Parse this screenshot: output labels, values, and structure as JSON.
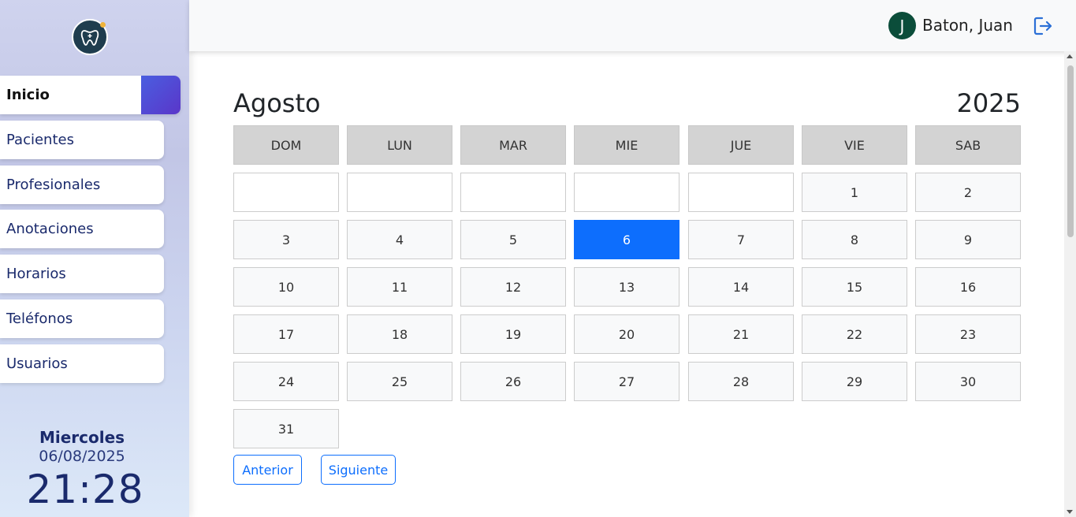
{
  "sidebar": {
    "items": [
      {
        "label": "Inicio",
        "active": true
      },
      {
        "label": "Pacientes"
      },
      {
        "label": "Profesionales"
      },
      {
        "label": "Anotaciones"
      },
      {
        "label": "Horarios"
      },
      {
        "label": "Teléfonos"
      },
      {
        "label": "Usuarios"
      }
    ],
    "clock": {
      "day": "Miercoles",
      "date": "06/08/2025",
      "time": "21:28"
    }
  },
  "header": {
    "user_initial": "J",
    "user_name": "Baton, Juan",
    "logout_icon": "logout-icon"
  },
  "calendar": {
    "month": "Agosto",
    "year": "2025",
    "weekdays": [
      "DOM",
      "LUN",
      "MAR",
      "MIE",
      "JUE",
      "VIE",
      "SAB"
    ],
    "weeks": [
      [
        "",
        "",
        "",
        "",
        "",
        "1",
        "2"
      ],
      [
        "3",
        "4",
        "5",
        "6",
        "7",
        "8",
        "9"
      ],
      [
        "10",
        "11",
        "12",
        "13",
        "14",
        "15",
        "16"
      ],
      [
        "17",
        "18",
        "19",
        "20",
        "21",
        "22",
        "23"
      ],
      [
        "24",
        "25",
        "26",
        "27",
        "28",
        "29",
        "30"
      ],
      [
        "31"
      ]
    ],
    "selected_day": "6",
    "prev_label": "Anterior",
    "next_label": "Siguiente"
  },
  "colors": {
    "accent": "#0d6efd",
    "sidebar_text": "#1a2a6c",
    "avatar": "#0b4d3a"
  }
}
